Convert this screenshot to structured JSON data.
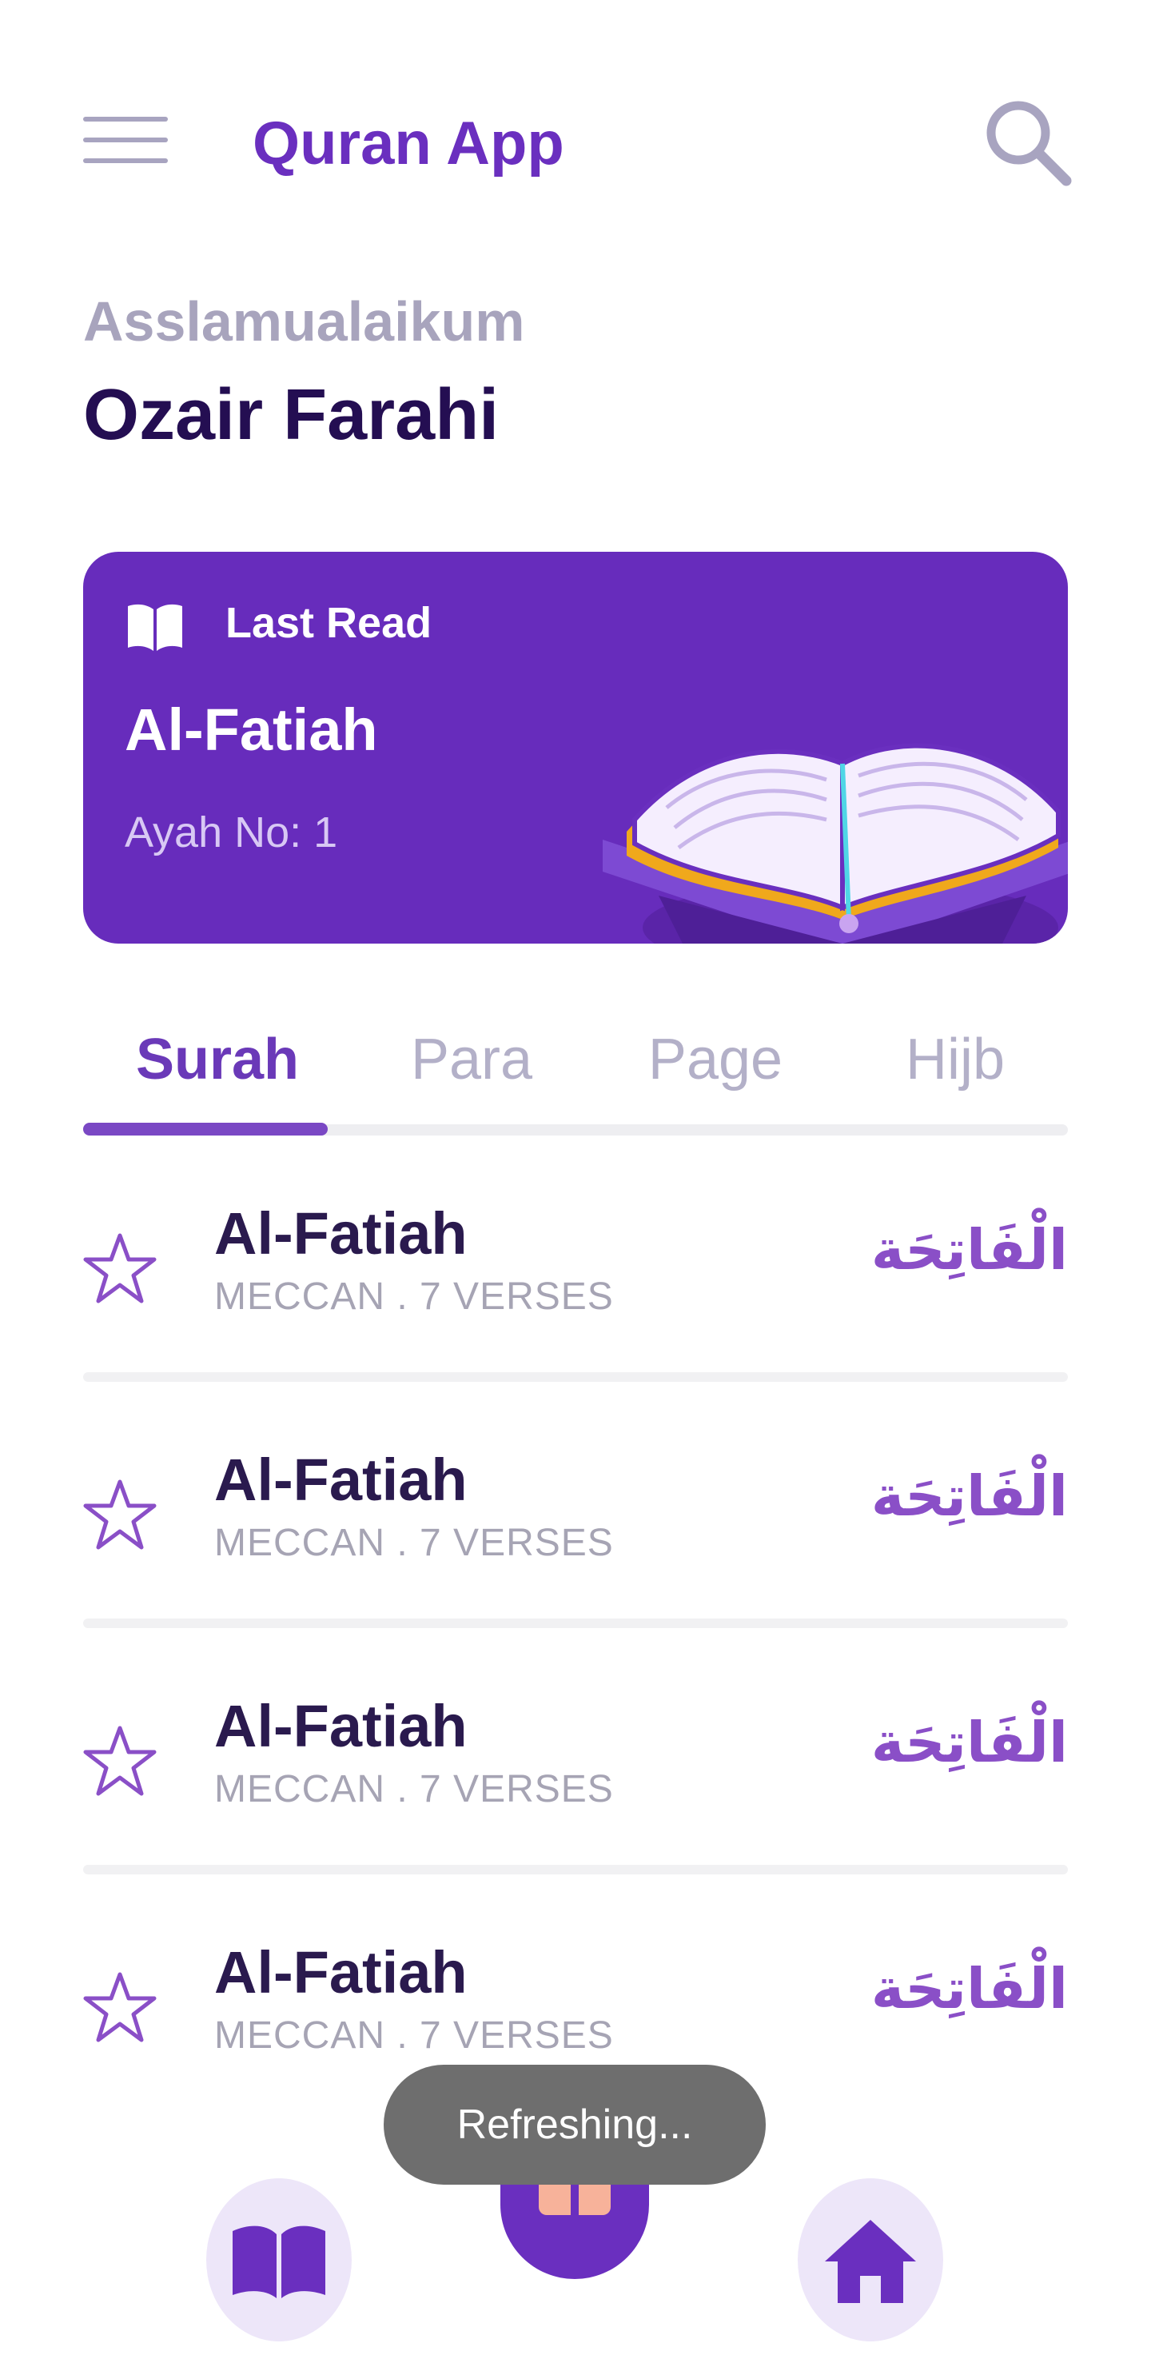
{
  "header": {
    "title": "Quran App",
    "menu_icon": "hamburger-menu-icon",
    "search_icon": "search-icon"
  },
  "greeting": {
    "salutation": "Asslamualaikum",
    "user_name": "Ozair Farahi"
  },
  "last_read": {
    "label": "Last Read",
    "surah": "Al-Fatiah",
    "ayah": "Ayah No: 1",
    "icon": "open-book-icon"
  },
  "tabs": [
    {
      "label": "Surah",
      "active": true
    },
    {
      "label": "Para",
      "active": false
    },
    {
      "label": "Page",
      "active": false
    },
    {
      "label": "Hijb",
      "active": false
    }
  ],
  "surahs": [
    {
      "name": "Al-Fatiah",
      "meta": "MECCAN . 7 VERSES",
      "arabic": "الْفَاتِحَة"
    },
    {
      "name": "Al-Fatiah",
      "meta": "MECCAN . 7 VERSES",
      "arabic": "الْفَاتِحَة"
    },
    {
      "name": "Al-Fatiah",
      "meta": "MECCAN . 7 VERSES",
      "arabic": "الْفَاتِحَة"
    },
    {
      "name": "Al-Fatiah",
      "meta": "MECCAN . 7 VERSES",
      "arabic": "الْفَاتِحَة"
    }
  ],
  "toast": {
    "text": "Refreshing..."
  },
  "bottom_nav": {
    "items": [
      "book-icon",
      "bookmark-book-icon",
      "home-icon"
    ]
  },
  "colors": {
    "accent": "#672cbc",
    "title": "#6a2fbf",
    "muted": "#a8a4bd",
    "dark": "#240e52"
  }
}
